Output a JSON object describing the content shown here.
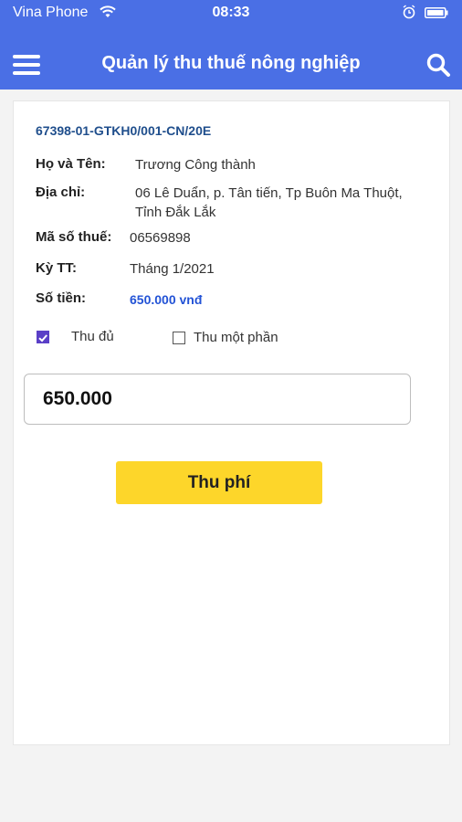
{
  "status_bar": {
    "carrier": "Vina Phone",
    "time": "08:33",
    "icons": [
      "wifi-icon",
      "alarm-icon",
      "battery-icon"
    ]
  },
  "header": {
    "title": "Quản lý thu thuế nông nghiệp",
    "menu_icon": "hamburger-menu-icon",
    "search_icon": "search-icon",
    "background_color": "#4a6fe5"
  },
  "record": {
    "code": "67398-01-GTKH0/001-CN/20E",
    "fields": {
      "name": {
        "label": "Họ và Tên:",
        "value": "Trương Công thành"
      },
      "address": {
        "label": "Địa chỉ:",
        "value_line1": "06 Lê Duẩn, p. Tân tiến, Tp Buôn Ma Thuột,",
        "value_line2": "Tỉnh Đắk  Lắk"
      },
      "tax_code": {
        "label": "Mã số thuế:",
        "value": "06569898"
      },
      "period": {
        "label": "Kỳ TT:",
        "value": "Tháng 1/2021"
      },
      "amount": {
        "label": "Số tiền:",
        "value": "650.000 vnđ"
      }
    }
  },
  "payment_options": {
    "full": {
      "label": "Thu đủ",
      "checked": true
    },
    "partial": {
      "label": "Thu một phần",
      "checked": false
    }
  },
  "amount_input": {
    "value": "650.000"
  },
  "actions": {
    "pay_label": "Thu phí",
    "pay_color": "#fdd62a"
  }
}
